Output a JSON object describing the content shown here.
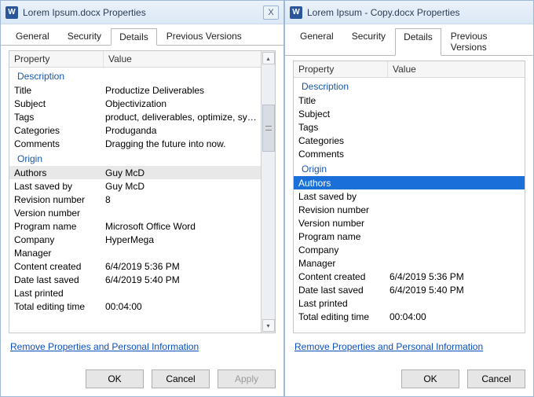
{
  "windows": [
    {
      "icon_letter": "W",
      "title": "Lorem Ipsum.docx Properties",
      "close": "X",
      "tabs": [
        "General",
        "Security",
        "Details",
        "Previous Versions"
      ],
      "active_tab": 2,
      "headers": {
        "property": "Property",
        "value": "Value"
      },
      "groups": [
        {
          "name": "Description",
          "rows": [
            {
              "prop": "Title",
              "val": "Productize Deliverables"
            },
            {
              "prop": "Subject",
              "val": "Objectivization"
            },
            {
              "prop": "Tags",
              "val": "product, deliverables, optimize, sync..."
            },
            {
              "prop": "Categories",
              "val": "Produganda"
            },
            {
              "prop": "Comments",
              "val": "Dragging the future into now."
            }
          ]
        },
        {
          "name": "Origin",
          "rows": [
            {
              "prop": "Authors",
              "val": "Guy McD",
              "hi": true
            },
            {
              "prop": "Last saved by",
              "val": "Guy McD"
            },
            {
              "prop": "Revision number",
              "val": "8"
            },
            {
              "prop": "Version number",
              "val": ""
            },
            {
              "prop": "Program name",
              "val": "Microsoft Office Word"
            },
            {
              "prop": "Company",
              "val": "HyperMega"
            },
            {
              "prop": "Manager",
              "val": ""
            },
            {
              "prop": "Content created",
              "val": "6/4/2019 5:36 PM"
            },
            {
              "prop": "Date last saved",
              "val": "6/4/2019 5:40 PM"
            },
            {
              "prop": "Last printed",
              "val": ""
            },
            {
              "prop": "Total editing time",
              "val": "00:04:00"
            }
          ]
        }
      ],
      "link": "Remove Properties and Personal Information",
      "buttons": {
        "ok": "OK",
        "cancel": "Cancel",
        "apply": "Apply",
        "apply_disabled": true
      },
      "scrollbar": true
    },
    {
      "icon_letter": "W",
      "title": "Lorem Ipsum - Copy.docx Properties",
      "close": "",
      "tabs": [
        "General",
        "Security",
        "Details",
        "Previous Versions"
      ],
      "active_tab": 2,
      "headers": {
        "property": "Property",
        "value": "Value"
      },
      "groups": [
        {
          "name": "Description",
          "rows": [
            {
              "prop": "Title",
              "val": ""
            },
            {
              "prop": "Subject",
              "val": ""
            },
            {
              "prop": "Tags",
              "val": ""
            },
            {
              "prop": "Categories",
              "val": ""
            },
            {
              "prop": "Comments",
              "val": ""
            }
          ]
        },
        {
          "name": "Origin",
          "rows": [
            {
              "prop": "Authors",
              "val": "",
              "sel": true
            },
            {
              "prop": "Last saved by",
              "val": ""
            },
            {
              "prop": "Revision number",
              "val": ""
            },
            {
              "prop": "Version number",
              "val": ""
            },
            {
              "prop": "Program name",
              "val": ""
            },
            {
              "prop": "Company",
              "val": ""
            },
            {
              "prop": "Manager",
              "val": ""
            },
            {
              "prop": "Content created",
              "val": "6/4/2019 5:36 PM"
            },
            {
              "prop": "Date last saved",
              "val": "6/4/2019 5:40 PM"
            },
            {
              "prop": "Last printed",
              "val": ""
            },
            {
              "prop": "Total editing time",
              "val": "00:04:00"
            }
          ]
        }
      ],
      "link": "Remove Properties and Personal Information",
      "buttons": {
        "ok": "OK",
        "cancel": "Cancel",
        "apply": "",
        "apply_disabled": true
      },
      "scrollbar": false
    }
  ]
}
